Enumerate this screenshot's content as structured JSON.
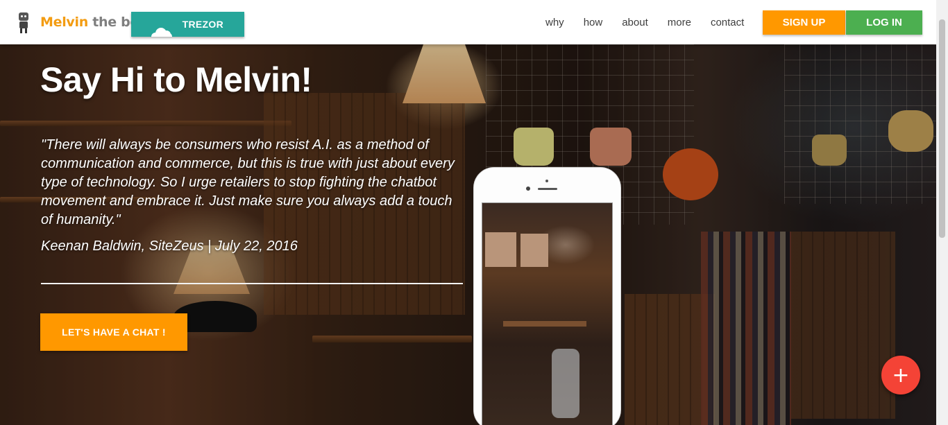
{
  "navbar": {
    "brand_part1": "Melvin",
    "brand_part2": "the bot",
    "trezor_label": "TREZOR",
    "links": [
      "why",
      "how",
      "about",
      "more",
      "contact"
    ],
    "signup_label": "SIGN UP",
    "login_label": "LOG IN"
  },
  "hero": {
    "title": "Say Hi to Melvin!",
    "quote": "\"There will always be consumers who resist A.I. as a method of communication and commerce, but this is true with just about every type of technology. So I urge retailers to stop fighting the chatbot movement and embrace it. Just make sure you always add a touch of humanity.\"",
    "attribution": "Keenan Baldwin, SiteZeus | July 22, 2016",
    "chat_button": "LET'S HAVE A CHAT !"
  },
  "fab": {
    "icon": "plus-icon",
    "symbol": "+"
  },
  "colors": {
    "brand_orange": "#f39c12",
    "brand_gray": "#7f7f7f",
    "teal": "#26a69a",
    "orange": "#ff9800",
    "green": "#4caf50",
    "red": "#f44336"
  }
}
